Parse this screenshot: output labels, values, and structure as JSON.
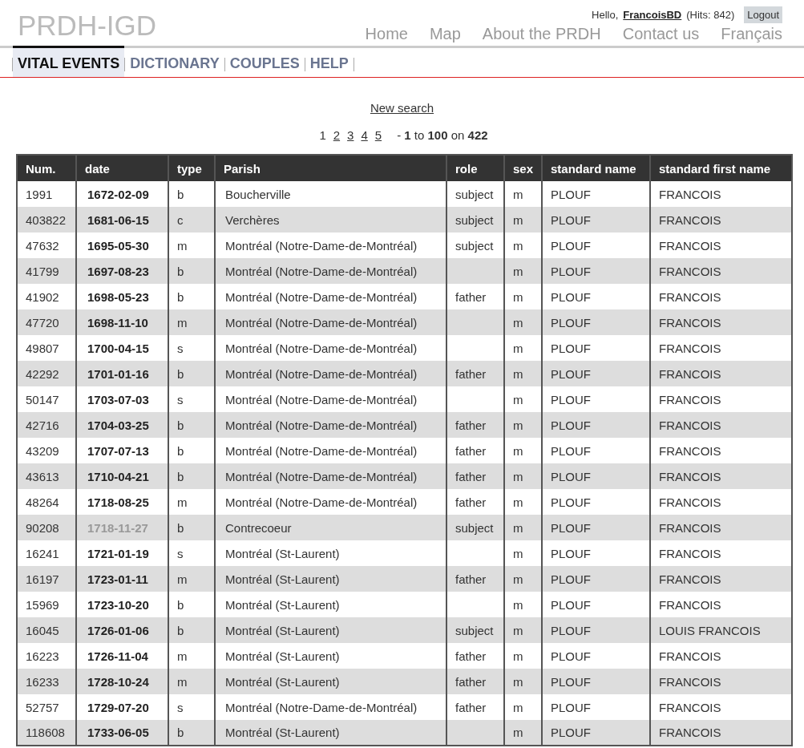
{
  "site_title": "PRDH-IGD",
  "user": {
    "greeting": "Hello,",
    "name": "FrancoisBD",
    "hits": "(Hits: 842)",
    "logout": "Logout"
  },
  "nav": [
    "Home",
    "Map",
    "About the PRDH",
    "Contact us",
    "Français"
  ],
  "tabs": [
    {
      "label": "VITAL EVENTS",
      "selected": true
    },
    {
      "label": "DICTIONARY",
      "selected": false
    },
    {
      "label": "COUPLES",
      "selected": false
    },
    {
      "label": "HELP",
      "selected": false
    }
  ],
  "new_search": "New search",
  "pager": {
    "pages": [
      {
        "label": "1",
        "selected": true
      },
      {
        "label": "2",
        "selected": false
      },
      {
        "label": "3",
        "selected": false
      },
      {
        "label": "4",
        "selected": false
      },
      {
        "label": "5",
        "selected": false
      }
    ],
    "range": "- **1** to **100** on **422**"
  },
  "table": {
    "columns": [
      "Num.",
      "date",
      "type",
      "Parish",
      "role",
      "sex",
      "standard name",
      "standard first name"
    ],
    "rows": [
      {
        "num": "1991",
        "date": "1672-02-09",
        "dimmed": false,
        "type": "b",
        "parish": "Boucherville",
        "role": "subject",
        "sex": "m",
        "name": "PLOUF",
        "first_name": "FRANCOIS"
      },
      {
        "num": "403822",
        "date": "1681-06-15",
        "dimmed": false,
        "type": "c",
        "parish": "Verchères",
        "role": "subject",
        "sex": "m",
        "name": "PLOUF",
        "first_name": "FRANCOIS"
      },
      {
        "num": "47632",
        "date": "1695-05-30",
        "dimmed": false,
        "type": "m",
        "parish": "Montréal (Notre-Dame-de-Montréal)",
        "role": "subject",
        "sex": "m",
        "name": "PLOUF",
        "first_name": "FRANCOIS"
      },
      {
        "num": "41799",
        "date": "1697-08-23",
        "dimmed": false,
        "type": "b",
        "parish": "Montréal (Notre-Dame-de-Montréal)",
        "role": "",
        "sex": "m",
        "name": "PLOUF",
        "first_name": "FRANCOIS"
      },
      {
        "num": "41902",
        "date": "1698-05-23",
        "dimmed": false,
        "type": "b",
        "parish": "Montréal (Notre-Dame-de-Montréal)",
        "role": "father",
        "sex": "m",
        "name": "PLOUF",
        "first_name": "FRANCOIS"
      },
      {
        "num": "47720",
        "date": "1698-11-10",
        "dimmed": false,
        "type": "m",
        "parish": "Montréal (Notre-Dame-de-Montréal)",
        "role": "",
        "sex": "m",
        "name": "PLOUF",
        "first_name": "FRANCOIS"
      },
      {
        "num": "49807",
        "date": "1700-04-15",
        "dimmed": false,
        "type": "s",
        "parish": "Montréal (Notre-Dame-de-Montréal)",
        "role": "",
        "sex": "m",
        "name": "PLOUF",
        "first_name": "FRANCOIS"
      },
      {
        "num": "42292",
        "date": "1701-01-16",
        "dimmed": false,
        "type": "b",
        "parish": "Montréal (Notre-Dame-de-Montréal)",
        "role": "father",
        "sex": "m",
        "name": "PLOUF",
        "first_name": "FRANCOIS"
      },
      {
        "num": "50147",
        "date": "1703-07-03",
        "dimmed": false,
        "type": "s",
        "parish": "Montréal (Notre-Dame-de-Montréal)",
        "role": "",
        "sex": "m",
        "name": "PLOUF",
        "first_name": "FRANCOIS"
      },
      {
        "num": "42716",
        "date": "1704-03-25",
        "dimmed": false,
        "type": "b",
        "parish": "Montréal (Notre-Dame-de-Montréal)",
        "role": "father",
        "sex": "m",
        "name": "PLOUF",
        "first_name": "FRANCOIS"
      },
      {
        "num": "43209",
        "date": "1707-07-13",
        "dimmed": false,
        "type": "b",
        "parish": "Montréal (Notre-Dame-de-Montréal)",
        "role": "father",
        "sex": "m",
        "name": "PLOUF",
        "first_name": "FRANCOIS"
      },
      {
        "num": "43613",
        "date": "1710-04-21",
        "dimmed": false,
        "type": "b",
        "parish": "Montréal (Notre-Dame-de-Montréal)",
        "role": "father",
        "sex": "m",
        "name": "PLOUF",
        "first_name": "FRANCOIS"
      },
      {
        "num": "48264",
        "date": "1718-08-25",
        "dimmed": false,
        "type": "m",
        "parish": "Montréal (Notre-Dame-de-Montréal)",
        "role": "father",
        "sex": "m",
        "name": "PLOUF",
        "first_name": "FRANCOIS"
      },
      {
        "num": "90208",
        "date": "1718-11-27",
        "dimmed": true,
        "type": "b",
        "parish": "Contrecoeur",
        "role": "subject",
        "sex": "m",
        "name": "PLOUF",
        "first_name": "FRANCOIS"
      },
      {
        "num": "16241",
        "date": "1721-01-19",
        "dimmed": false,
        "type": "s",
        "parish": "Montréal (St-Laurent)",
        "role": "",
        "sex": "m",
        "name": "PLOUF",
        "first_name": "FRANCOIS"
      },
      {
        "num": "16197",
        "date": "1723-01-11",
        "dimmed": false,
        "type": "m",
        "parish": "Montréal (St-Laurent)",
        "role": "father",
        "sex": "m",
        "name": "PLOUF",
        "first_name": "FRANCOIS"
      },
      {
        "num": "15969",
        "date": "1723-10-20",
        "dimmed": false,
        "type": "b",
        "parish": "Montréal (St-Laurent)",
        "role": "",
        "sex": "m",
        "name": "PLOUF",
        "first_name": "FRANCOIS"
      },
      {
        "num": "16045",
        "date": "1726-01-06",
        "dimmed": false,
        "type": "b",
        "parish": "Montréal (St-Laurent)",
        "role": "subject",
        "sex": "m",
        "name": "PLOUF",
        "first_name": "LOUIS FRANCOIS"
      },
      {
        "num": "16223",
        "date": "1726-11-04",
        "dimmed": false,
        "type": "m",
        "parish": "Montréal (St-Laurent)",
        "role": "father",
        "sex": "m",
        "name": "PLOUF",
        "first_name": "FRANCOIS"
      },
      {
        "num": "16233",
        "date": "1728-10-24",
        "dimmed": false,
        "type": "m",
        "parish": "Montréal (St-Laurent)",
        "role": "father",
        "sex": "m",
        "name": "PLOUF",
        "first_name": "FRANCOIS"
      },
      {
        "num": "52757",
        "date": "1729-07-20",
        "dimmed": false,
        "type": "s",
        "parish": "Montréal (Notre-Dame-de-Montréal)",
        "role": "father",
        "sex": "m",
        "name": "PLOUF",
        "first_name": "FRANCOIS"
      },
      {
        "num": "118608",
        "date": "1733-06-05",
        "dimmed": false,
        "type": "b",
        "parish": "Montréal (St-Laurent)",
        "role": "",
        "sex": "m",
        "name": "PLOUF",
        "first_name": "FRANCOIS"
      }
    ]
  }
}
